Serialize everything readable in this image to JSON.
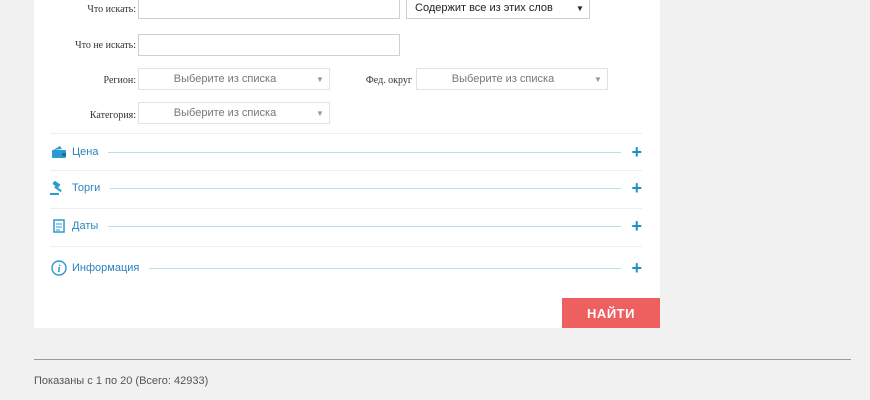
{
  "form": {
    "what_search_label": "Что искать:",
    "what_search_value": "",
    "match_mode": "Содержит все из этих слов",
    "exclude_label": "Что не искать:",
    "exclude_value": "",
    "region_label": "Регион:",
    "region_value": "Выберите из списка",
    "district_label": "Фед. округ",
    "district_value": "Выберите из списка",
    "category_label": "Категория:",
    "category_value": "Выберите из списка"
  },
  "sections": [
    {
      "label": "Цена",
      "icon": "wallet-icon"
    },
    {
      "label": "Торги",
      "icon": "gavel-icon"
    },
    {
      "label": "Даты",
      "icon": "document-icon"
    },
    {
      "label": "Информация",
      "icon": "info-icon"
    }
  ],
  "find_button": "НАЙТИ",
  "results_summary": "Показаны с 1 по 20 (Всего: 42933)",
  "colors": {
    "accent_blue": "#2a84bf",
    "find_red": "#ee5f5f",
    "background": "#f1f1f1"
  }
}
